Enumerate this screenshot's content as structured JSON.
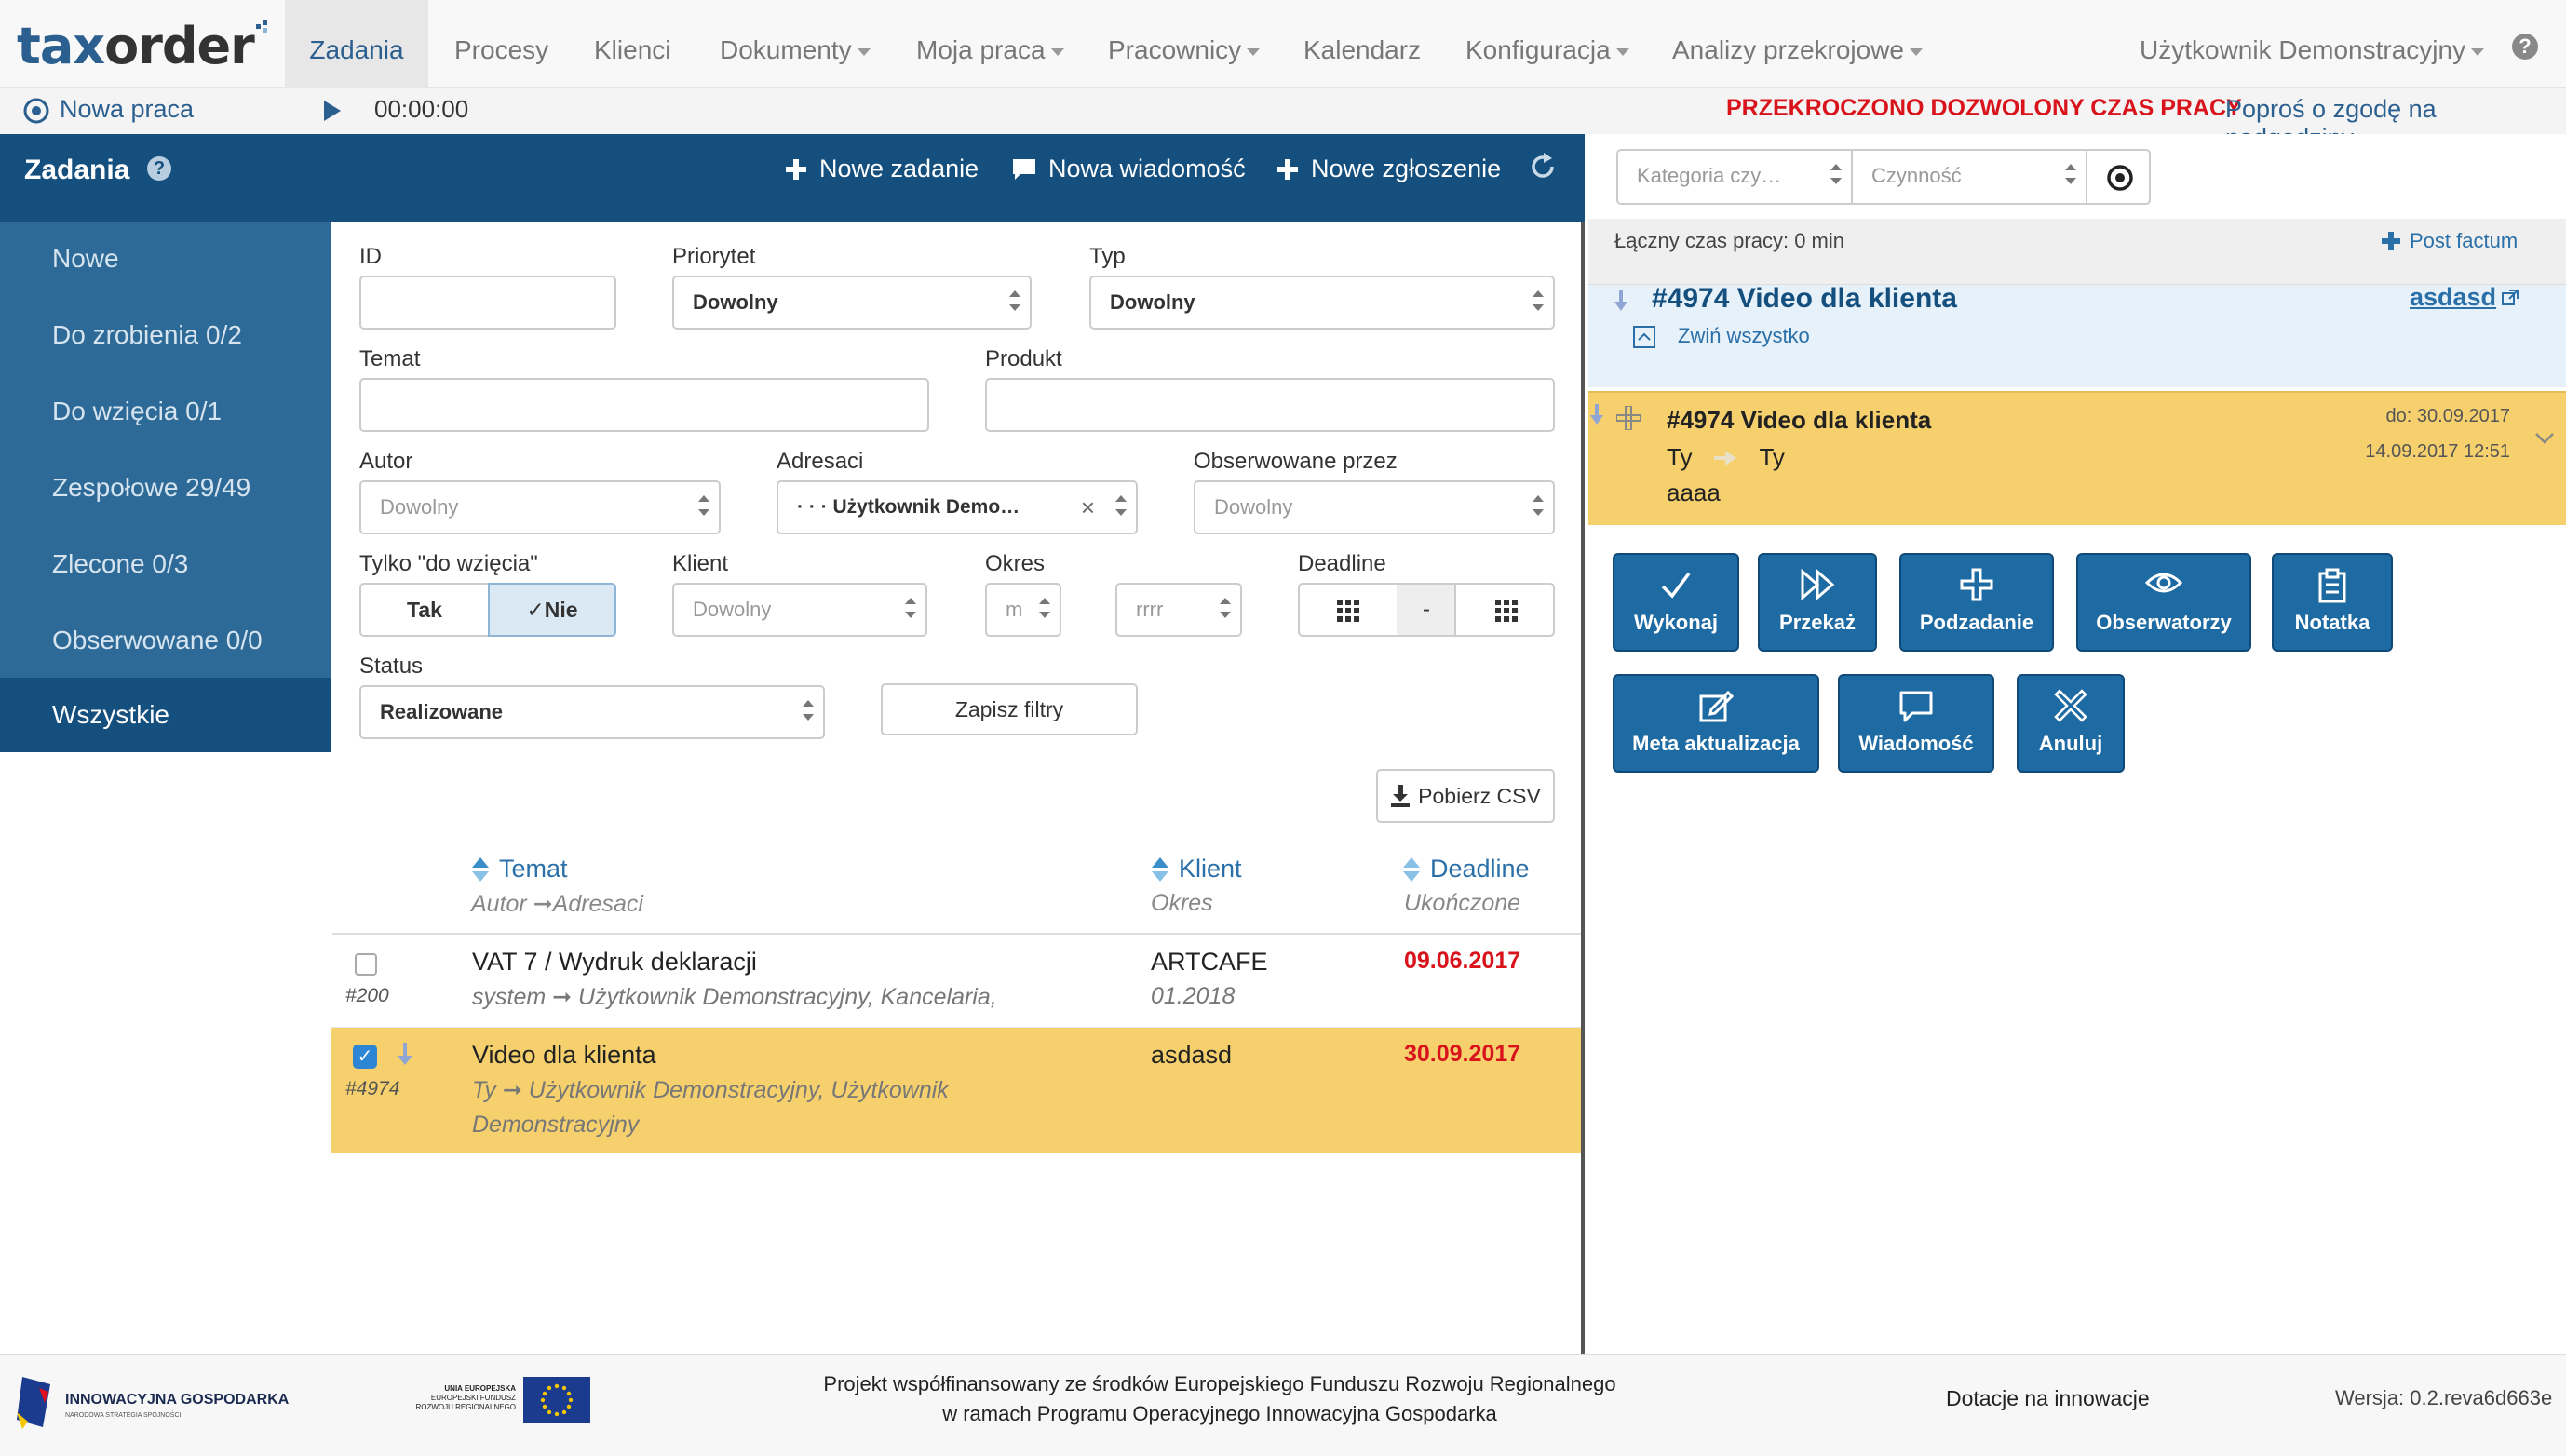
{
  "logo": {
    "part1": "tax",
    "part2": "order"
  },
  "nav": {
    "items": [
      {
        "label": "Zadania"
      },
      {
        "label": "Procesy"
      },
      {
        "label": "Klienci"
      },
      {
        "label": "Dokumenty"
      },
      {
        "label": "Moja praca"
      },
      {
        "label": "Pracownicy"
      },
      {
        "label": "Kalendarz"
      },
      {
        "label": "Konfiguracja"
      },
      {
        "label": "Analizy przekrojowe"
      }
    ],
    "user": "Użytkownik Demonstracyjny",
    "help_icon": "question-circle-icon"
  },
  "subbar": {
    "new_work": "Nowa praca",
    "timer": "00:00:00",
    "warning": "PRZEKROCZONO DOZWOLONY CZAS PRACY",
    "overtime_link": "Poproś o zgodę na nadgodziny"
  },
  "tasks_header": {
    "title": "Zadania",
    "new_task": "Nowe zadanie",
    "new_message": "Nowa wiadomość",
    "new_report": "Nowe zgłoszenie"
  },
  "sidebar": {
    "items": [
      {
        "label": "Nowe"
      },
      {
        "label": "Do zrobienia 0/2"
      },
      {
        "label": "Do wzięcia 0/1"
      },
      {
        "label": "Zespołowe 29/49"
      },
      {
        "label": "Zlecone 0/3"
      },
      {
        "label": "Obserwowane 0/0"
      },
      {
        "label": "Wszystkie"
      }
    ]
  },
  "filters": {
    "id_label": "ID",
    "id_value": "",
    "priority_label": "Priorytet",
    "priority_value": "Dowolny",
    "type_label": "Typ",
    "type_value": "Dowolny",
    "subject_label": "Temat",
    "subject_value": "",
    "product_label": "Produkt",
    "product_value": "",
    "author_label": "Autor",
    "author_value": "Dowolny",
    "recipients_label": "Adresaci",
    "recipients_value": "· · · Użytkownik Demo…",
    "observed_label": "Obserwowane przez",
    "observed_value": "Dowolny",
    "only_take_label": "Tylko \"do wzięcia\"",
    "yes": "Tak",
    "no": "✓Nie",
    "client_label": "Klient",
    "client_value": "Dowolny",
    "period_label": "Okres",
    "period_month": "m",
    "period_year": "rrrr",
    "deadline_label": "Deadline",
    "deadline_sep": "-",
    "status_label": "Status",
    "status_value": "Realizowane",
    "save_filters": "Zapisz filtry",
    "download_csv": "Pobierz CSV"
  },
  "table": {
    "col_subject": "Temat",
    "col_subject_sub": "Autor ➞Adresaci",
    "col_client": "Klient",
    "col_client_sub": "Okres",
    "col_deadline": "Deadline",
    "col_deadline_sub": "Ukończone",
    "rows": [
      {
        "id": "#200",
        "subject": "VAT 7 / Wydruk deklaracji",
        "people": "system ➞ Użytkownik Demonstracyjny, Kancelaria,",
        "people2": "",
        "client": "ARTCAFE",
        "period": "01.2018",
        "deadline": "09.06.2017",
        "checked": false
      },
      {
        "id": "#4974",
        "subject": "Video dla klienta",
        "people": "Ty ➞ Użytkownik Demonstracyjny, Użytkownik",
        "people2": "Demonstracyjny",
        "client": "asdasd",
        "period": "",
        "deadline": "30.09.2017",
        "checked": true
      }
    ]
  },
  "right": {
    "category_placeholder": "Kategoria czy…",
    "activity_placeholder": "Czynność",
    "total_time": "Łączny czas pracy: 0 min",
    "post_factum": "Post factum",
    "task_title": "#4974 Video dla klienta",
    "task_client": "asdasd",
    "collapse_all": "Zwiń wszystko",
    "card_title": "#4974 Video dla klienta",
    "card_from": "Ty",
    "card_to": "Ty",
    "card_body": "aaaa",
    "card_due": "do: 30.09.2017",
    "card_date": "14.09.2017 12:51",
    "actions": [
      {
        "label": "Wykonaj",
        "icon": "check-icon"
      },
      {
        "label": "Przekaż",
        "icon": "forward-icon"
      },
      {
        "label": "Podzadanie",
        "icon": "plus-icon"
      },
      {
        "label": "Obserwatorzy",
        "icon": "eye-icon"
      },
      {
        "label": "Notatka",
        "icon": "clipboard-icon"
      },
      {
        "label": "Meta aktualizacja",
        "icon": "edit-icon"
      },
      {
        "label": "Wiadomość",
        "icon": "message-icon"
      },
      {
        "label": "Anuluj",
        "icon": "x-icon"
      }
    ]
  },
  "footer": {
    "logo1": "INNOWACYJNA GOSPODARKA",
    "logo1_sub": "NARODOWA STRATEGIA SPÓJNOŚCI",
    "logo2_line1": "UNIA EUROPEJSKA",
    "logo2_line2": "EUROPEJSKI FUNDUSZ",
    "logo2_line3": "ROZWOJU REGIONALNEGO",
    "project_line1": "Projekt współfinansowany ze środków Europejskiego Funduszu Rozwoju Regionalnego",
    "project_line2": "w ramach Programu Operacyjnego Innowacyjna Gospodarka",
    "grants": "Dotacje na innowacje",
    "version": "Wersja: 0.2.reva6d663e"
  },
  "colors": {
    "primary": "#144f7e",
    "sidebar": "#2e6a97",
    "highlight": "#f5d06d",
    "warning": "#d9131b",
    "button": "#1e6aa2"
  }
}
